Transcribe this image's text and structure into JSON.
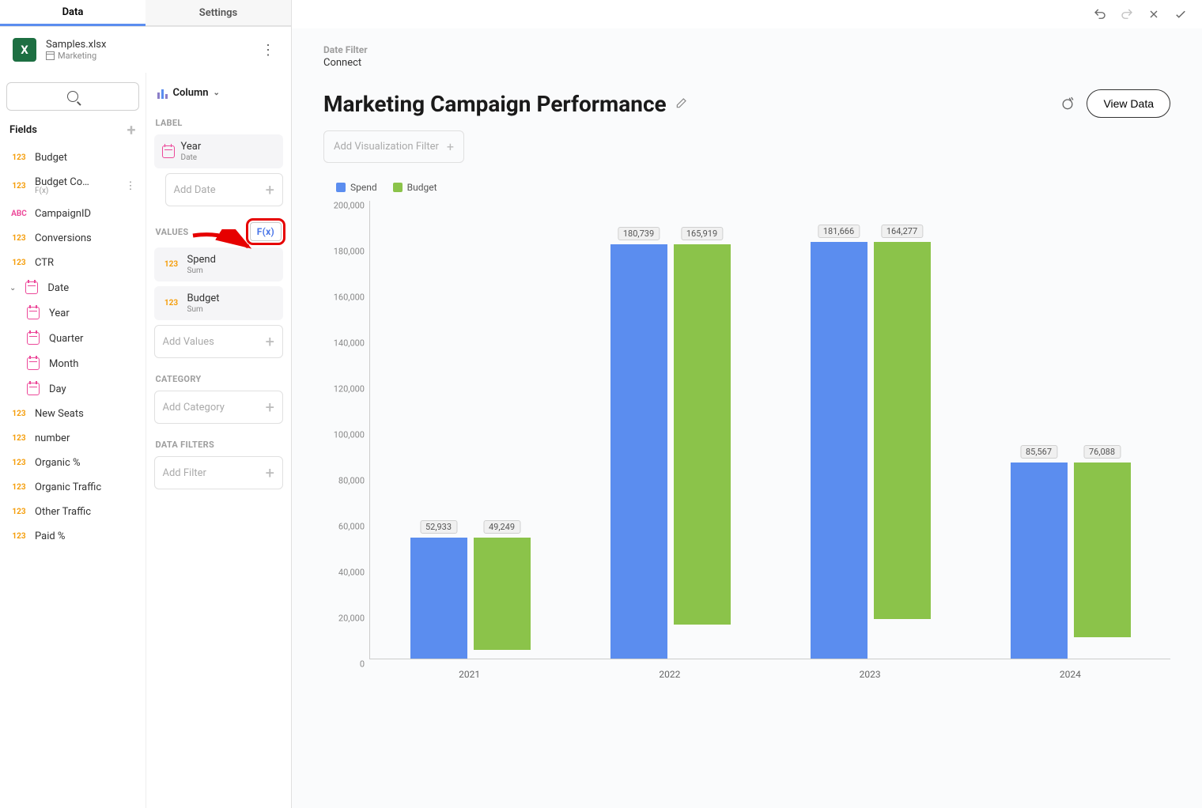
{
  "tabs": {
    "data": "Data",
    "settings": "Settings"
  },
  "file": {
    "name": "Samples.xlsx",
    "sheet": "Marketing"
  },
  "fields_header": "Fields",
  "fields": [
    {
      "type": "num",
      "name": "Budget"
    },
    {
      "type": "num",
      "name": "Budget Co…",
      "sub": "F(x)",
      "menu": true
    },
    {
      "type": "abc",
      "name": "CampaignID"
    },
    {
      "type": "num",
      "name": "Conversions"
    },
    {
      "type": "num",
      "name": "CTR"
    },
    {
      "type": "date",
      "name": "Date",
      "expanded": true,
      "children": [
        {
          "type": "date",
          "name": "Year"
        },
        {
          "type": "date",
          "name": "Quarter"
        },
        {
          "type": "date",
          "name": "Month"
        },
        {
          "type": "date",
          "name": "Day"
        }
      ]
    },
    {
      "type": "num",
      "name": "New Seats"
    },
    {
      "type": "num",
      "name": "number"
    },
    {
      "type": "num",
      "name": "Organic %"
    },
    {
      "type": "num",
      "name": "Organic Traffic"
    },
    {
      "type": "num",
      "name": "Other Traffic"
    },
    {
      "type": "num",
      "name": "Paid %"
    }
  ],
  "chart_type": "Column",
  "config": {
    "label_header": "LABEL",
    "label_item": {
      "name": "Year",
      "sub": "Date"
    },
    "add_date": "Add Date",
    "values_header": "VALUES",
    "fx": "F(x)",
    "values": [
      {
        "name": "Spend",
        "sub": "Sum"
      },
      {
        "name": "Budget",
        "sub": "Sum"
      }
    ],
    "add_values": "Add Values",
    "category_header": "CATEGORY",
    "add_category": "Add Category",
    "filters_header": "DATA FILTERS",
    "add_filter": "Add Filter"
  },
  "header": {
    "date_filter_label": "Date Filter",
    "date_filter_value": "Connect",
    "title": "Marketing Campaign Performance",
    "view_data": "View Data",
    "add_viz_filter": "Add Visualization Filter"
  },
  "legend": {
    "spend": "Spend",
    "budget": "Budget",
    "spend_color": "#5B8DEF",
    "budget_color": "#8BC34A"
  },
  "chart_data": {
    "type": "bar",
    "title": "Marketing Campaign Performance",
    "xlabel": "",
    "ylabel": "",
    "ylim": [
      0,
      200000
    ],
    "y_ticks": [
      0,
      20000,
      40000,
      60000,
      80000,
      100000,
      120000,
      140000,
      160000,
      180000,
      200000
    ],
    "y_tick_labels": [
      "0",
      "20,000",
      "40,000",
      "60,000",
      "80,000",
      "100,000",
      "120,000",
      "140,000",
      "160,000",
      "180,000",
      "200,000"
    ],
    "categories": [
      "2021",
      "2022",
      "2023",
      "2024"
    ],
    "series": [
      {
        "name": "Spend",
        "color": "#5B8DEF",
        "values": [
          52933,
          180739,
          181666,
          85567
        ],
        "labels": [
          "52,933",
          "180,739",
          "181,666",
          "85,567"
        ]
      },
      {
        "name": "Budget",
        "color": "#8BC34A",
        "values": [
          49249,
          165919,
          164277,
          76088
        ],
        "labels": [
          "49,249",
          "165,919",
          "164,277",
          "76,088"
        ]
      }
    ]
  }
}
